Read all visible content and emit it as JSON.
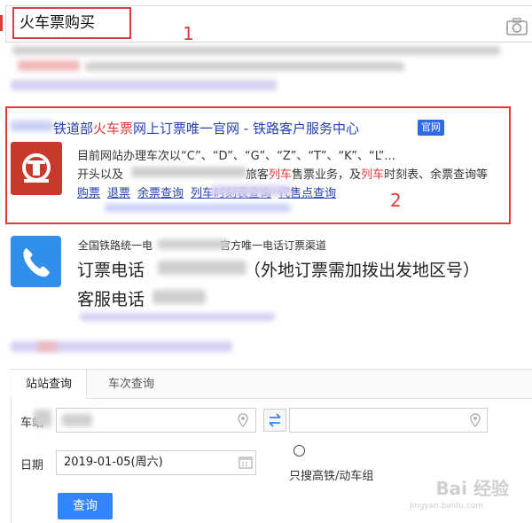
{
  "search": {
    "query": "火车票购买",
    "annotation_1": "1"
  },
  "result1": {
    "title_prefix": "铁道部",
    "title_highlight": "火车票",
    "title_suffix": "网上订票唯一官网 - 铁路客户服务中心",
    "badge": "官网",
    "desc_line1": "目前网站办理车次以“C”、“D”、“G”、“Z”、“T”、“K”、“L”...",
    "desc_line2_a": "开头以及",
    "desc_line2_b": "旅客",
    "desc_line2_c": "列车",
    "desc_line2_d": "售票业务，及",
    "desc_line2_e": "列车",
    "desc_line2_f": "时刻表、余票查询等",
    "links": [
      "购票",
      "退票",
      "余票查询",
      "列车时刻表查询",
      "代售点查询"
    ],
    "annotation_2": "2"
  },
  "result2": {
    "line1_a": "全国铁路统一电",
    "line1_b": "官方唯一电话订票渠道",
    "line2_a": "订票电话",
    "line2_b": "（外地订票需加拨出发地区号）",
    "line3": "客服电话"
  },
  "widget": {
    "tabs": [
      "站站查询",
      "车次查询"
    ],
    "station_label": "车站",
    "date_label": "日期",
    "date_value": "2019-01-05(周六)",
    "highspeed_label": "只搜高铁/动车组",
    "query_button": "查询"
  },
  "watermark": {
    "main": "Bai 经验",
    "sub": "jingyan.baidu.com"
  }
}
